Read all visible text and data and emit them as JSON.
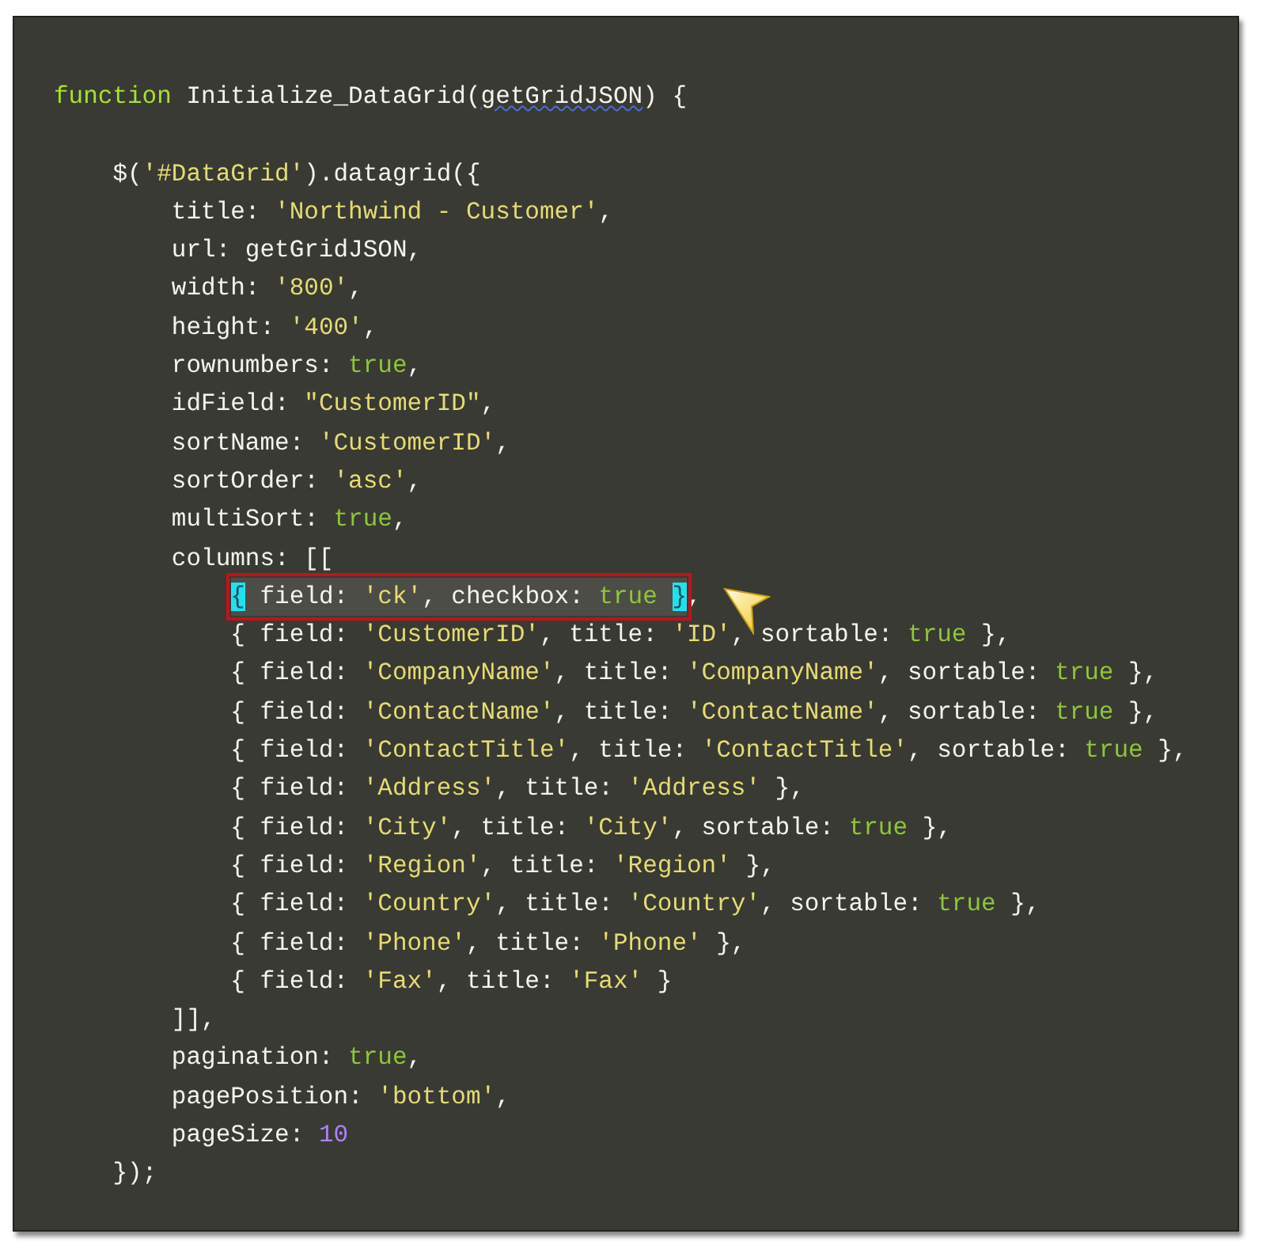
{
  "code_lines": [
    {
      "kind": "code",
      "tokens": [
        {
          "kind": "kw",
          "text": "function"
        },
        {
          "kind": "plain",
          "text": " Initialize_DataGrid("
        },
        {
          "kind": "err",
          "text": "getGridJSON"
        },
        {
          "kind": "plain",
          "text": ") {"
        }
      ]
    },
    {
      "kind": "blank"
    },
    {
      "kind": "code",
      "tokens": [
        {
          "kind": "plain",
          "text": "    $("
        },
        {
          "kind": "str",
          "text": "'#DataGrid'"
        },
        {
          "kind": "plain",
          "text": ").datagrid({"
        }
      ]
    },
    {
      "kind": "code",
      "tokens": [
        {
          "kind": "plain",
          "text": "        title: "
        },
        {
          "kind": "str",
          "text": "'Northwind - Customer'"
        },
        {
          "kind": "plain",
          "text": ","
        }
      ]
    },
    {
      "kind": "code",
      "tokens": [
        {
          "kind": "plain",
          "text": "        url: getGridJSON,"
        }
      ]
    },
    {
      "kind": "code",
      "tokens": [
        {
          "kind": "plain",
          "text": "        width: "
        },
        {
          "kind": "str",
          "text": "'800'"
        },
        {
          "kind": "plain",
          "text": ","
        }
      ]
    },
    {
      "kind": "code",
      "tokens": [
        {
          "kind": "plain",
          "text": "        height: "
        },
        {
          "kind": "str",
          "text": "'400'"
        },
        {
          "kind": "plain",
          "text": ","
        }
      ]
    },
    {
      "kind": "code",
      "tokens": [
        {
          "kind": "plain",
          "text": "        rownumbers: "
        },
        {
          "kind": "bool",
          "text": "true"
        },
        {
          "kind": "plain",
          "text": ","
        }
      ]
    },
    {
      "kind": "code",
      "tokens": [
        {
          "kind": "plain",
          "text": "        idField: "
        },
        {
          "kind": "str",
          "text": "\"CustomerID\""
        },
        {
          "kind": "plain",
          "text": ","
        }
      ]
    },
    {
      "kind": "code",
      "tokens": [
        {
          "kind": "plain",
          "text": "        sortName: "
        },
        {
          "kind": "str",
          "text": "'CustomerID'"
        },
        {
          "kind": "plain",
          "text": ","
        }
      ]
    },
    {
      "kind": "code",
      "tokens": [
        {
          "kind": "plain",
          "text": "        sortOrder: "
        },
        {
          "kind": "str",
          "text": "'asc'"
        },
        {
          "kind": "plain",
          "text": ","
        }
      ]
    },
    {
      "kind": "code",
      "tokens": [
        {
          "kind": "plain",
          "text": "        multiSort: "
        },
        {
          "kind": "bool",
          "text": "true"
        },
        {
          "kind": "plain",
          "text": ","
        }
      ]
    },
    {
      "kind": "code",
      "tokens": [
        {
          "kind": "plain",
          "text": "        columns: [["
        }
      ]
    },
    {
      "kind": "boxed",
      "boxed_tokens": [
        {
          "kind": "match",
          "text": "            {"
        },
        {
          "kind": "plain",
          "text": " field: "
        },
        {
          "kind": "str",
          "text": "'ck'"
        },
        {
          "kind": "plain",
          "text": ", checkbox: "
        },
        {
          "kind": "bool",
          "text": "true "
        },
        {
          "kind": "match",
          "text": "}"
        }
      ],
      "tokens": [
        {
          "kind": "plain",
          "text": ","
        }
      ]
    },
    {
      "kind": "code",
      "tokens": [
        {
          "kind": "plain",
          "text": "            { field: "
        },
        {
          "kind": "str",
          "text": "'CustomerID'"
        },
        {
          "kind": "plain",
          "text": ", title: "
        },
        {
          "kind": "str",
          "text": "'ID'"
        },
        {
          "kind": "plain",
          "text": ", sortable: "
        },
        {
          "kind": "bool",
          "text": "true"
        },
        {
          "kind": "plain",
          "text": " },"
        }
      ]
    },
    {
      "kind": "code",
      "tokens": [
        {
          "kind": "plain",
          "text": "            { field: "
        },
        {
          "kind": "str",
          "text": "'CompanyName'"
        },
        {
          "kind": "plain",
          "text": ", title: "
        },
        {
          "kind": "str",
          "text": "'CompanyName'"
        },
        {
          "kind": "plain",
          "text": ", sortable: "
        },
        {
          "kind": "bool",
          "text": "true"
        },
        {
          "kind": "plain",
          "text": " },"
        }
      ]
    },
    {
      "kind": "code",
      "tokens": [
        {
          "kind": "plain",
          "text": "            { field: "
        },
        {
          "kind": "str",
          "text": "'ContactName'"
        },
        {
          "kind": "plain",
          "text": ", title: "
        },
        {
          "kind": "str",
          "text": "'ContactName'"
        },
        {
          "kind": "plain",
          "text": ", sortable: "
        },
        {
          "kind": "bool",
          "text": "true"
        },
        {
          "kind": "plain",
          "text": " },"
        }
      ]
    },
    {
      "kind": "code",
      "tokens": [
        {
          "kind": "plain",
          "text": "            { field: "
        },
        {
          "kind": "str",
          "text": "'ContactTitle'"
        },
        {
          "kind": "plain",
          "text": ", title: "
        },
        {
          "kind": "str",
          "text": "'ContactTitle'"
        },
        {
          "kind": "plain",
          "text": ", sortable: "
        },
        {
          "kind": "bool",
          "text": "true"
        },
        {
          "kind": "plain",
          "text": " },"
        }
      ]
    },
    {
      "kind": "code",
      "tokens": [
        {
          "kind": "plain",
          "text": "            { field: "
        },
        {
          "kind": "str",
          "text": "'Address'"
        },
        {
          "kind": "plain",
          "text": ", title: "
        },
        {
          "kind": "str",
          "text": "'Address'"
        },
        {
          "kind": "plain",
          "text": " },"
        }
      ]
    },
    {
      "kind": "code",
      "tokens": [
        {
          "kind": "plain",
          "text": "            { field: "
        },
        {
          "kind": "str",
          "text": "'City'"
        },
        {
          "kind": "plain",
          "text": ", title: "
        },
        {
          "kind": "str",
          "text": "'City'"
        },
        {
          "kind": "plain",
          "text": ", sortable: "
        },
        {
          "kind": "bool",
          "text": "true"
        },
        {
          "kind": "plain",
          "text": " },"
        }
      ]
    },
    {
      "kind": "code",
      "tokens": [
        {
          "kind": "plain",
          "text": "            { field: "
        },
        {
          "kind": "str",
          "text": "'Region'"
        },
        {
          "kind": "plain",
          "text": ", title: "
        },
        {
          "kind": "str",
          "text": "'Region'"
        },
        {
          "kind": "plain",
          "text": " },"
        }
      ]
    },
    {
      "kind": "code",
      "tokens": [
        {
          "kind": "plain",
          "text": "            { field: "
        },
        {
          "kind": "str",
          "text": "'Country'"
        },
        {
          "kind": "plain",
          "text": ", title: "
        },
        {
          "kind": "str",
          "text": "'Country'"
        },
        {
          "kind": "plain",
          "text": ", sortable: "
        },
        {
          "kind": "bool",
          "text": "true"
        },
        {
          "kind": "plain",
          "text": " },"
        }
      ]
    },
    {
      "kind": "code",
      "tokens": [
        {
          "kind": "plain",
          "text": "            { field: "
        },
        {
          "kind": "str",
          "text": "'Phone'"
        },
        {
          "kind": "plain",
          "text": ", title: "
        },
        {
          "kind": "str",
          "text": "'Phone'"
        },
        {
          "kind": "plain",
          "text": " },"
        }
      ]
    },
    {
      "kind": "code",
      "tokens": [
        {
          "kind": "plain",
          "text": "            { field: "
        },
        {
          "kind": "str",
          "text": "'Fax'"
        },
        {
          "kind": "plain",
          "text": ", title: "
        },
        {
          "kind": "str",
          "text": "'Fax'"
        },
        {
          "kind": "plain",
          "text": " }"
        }
      ]
    },
    {
      "kind": "code",
      "tokens": [
        {
          "kind": "plain",
          "text": "        ]],"
        }
      ]
    },
    {
      "kind": "code",
      "tokens": [
        {
          "kind": "plain",
          "text": "        pagination: "
        },
        {
          "kind": "bool",
          "text": "true"
        },
        {
          "kind": "plain",
          "text": ","
        }
      ]
    },
    {
      "kind": "code",
      "tokens": [
        {
          "kind": "plain",
          "text": "        pagePosition: "
        },
        {
          "kind": "str",
          "text": "'bottom'"
        },
        {
          "kind": "plain",
          "text": ","
        }
      ]
    },
    {
      "kind": "code",
      "tokens": [
        {
          "kind": "plain",
          "text": "        pageSize: "
        },
        {
          "kind": "num",
          "text": "10"
        }
      ]
    },
    {
      "kind": "code",
      "tokens": [
        {
          "kind": "plain",
          "text": "    });"
        }
      ]
    }
  ]
}
